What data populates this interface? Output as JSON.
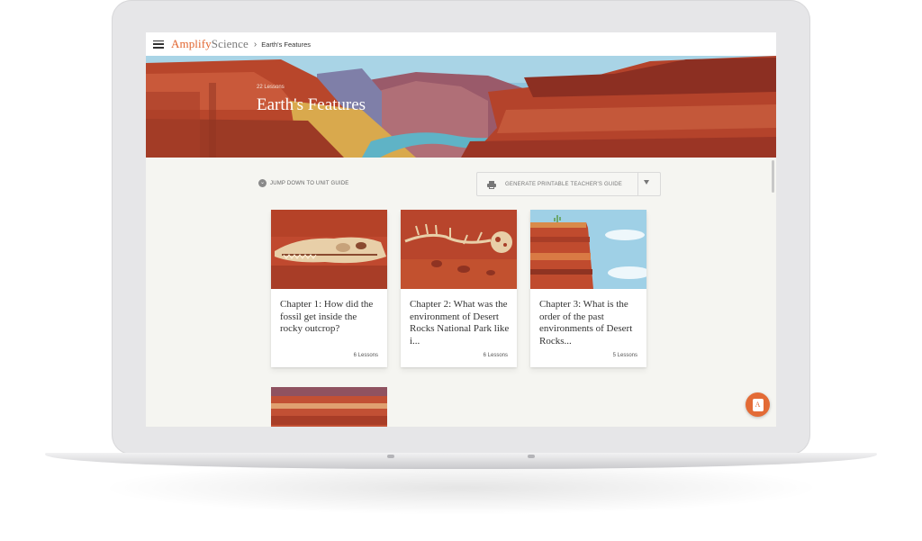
{
  "header": {
    "brand_part1": "Amplify",
    "brand_part2": "Science",
    "breadcrumb_separator": "›",
    "breadcrumb_current": "Earth's Features"
  },
  "hero": {
    "lesson_count": "22 Lessons",
    "title": "Earth's Features"
  },
  "controls": {
    "jump_label": "JUMP DOWN TO UNIT GUIDE",
    "generate_label": "GENERATE PRINTABLE TEACHER'S GUIDE"
  },
  "chapters": [
    {
      "title": "Chapter 1: How did the fossil get inside the rocky outcrop?",
      "lessons": "6 Lessons"
    },
    {
      "title": "Chapter 2: What was the environment of Desert Rocks National Park like i...",
      "lessons": "6 Lessons"
    },
    {
      "title": "Chapter 3: What is the order of the past environments of Desert Rocks...",
      "lessons": "5 Lessons"
    }
  ],
  "fab": {
    "letter": "A"
  },
  "colors": {
    "brand_orange": "#e2652f",
    "canyon_red": "#b6472c",
    "page_bg": "#f5f5f1"
  },
  "icons": [
    "menu-icon",
    "chevron-down-icon",
    "printer-icon",
    "caret-down-icon",
    "amplify-logo-icon"
  ]
}
